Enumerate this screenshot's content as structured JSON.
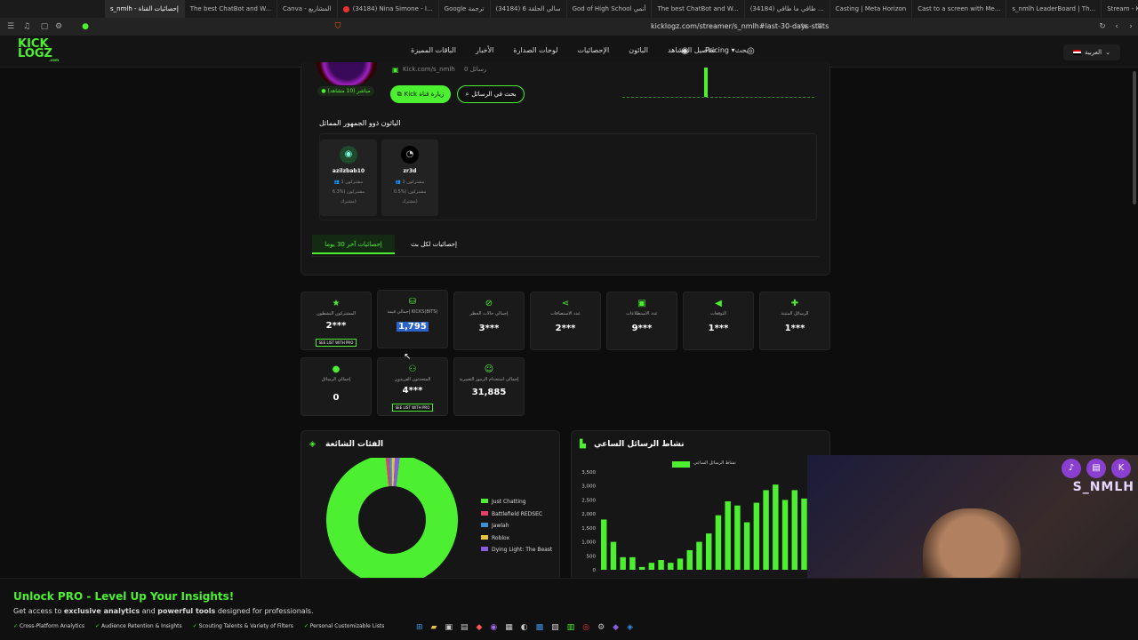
{
  "tabs": [
    {
      "label": "s_nmlh - إحصائيات القناة",
      "active": true
    },
    {
      "label": "The best ChatBot and W..."
    },
    {
      "label": "Canva - المشاريع"
    },
    {
      "label": "(34184) Nina Simone - I..."
    },
    {
      "label": "Google ترجمة"
    },
    {
      "label": "(34184) سالي الحلقة 6"
    },
    {
      "label": "God of High School أنمي"
    },
    {
      "label": "The best ChatBot and W..."
    },
    {
      "label": "(34184) طاقي ما طاقي ..."
    },
    {
      "label": "Casting | Meta Horizon"
    },
    {
      "label": "Cast to a screen with Me..."
    },
    {
      "label": "s_nmlh LeaderBoard | Th..."
    },
    {
      "label": "Stream - Kick Dashb..."
    }
  ],
  "address": {
    "url": "kicklogz.com/streamer/s_nmlh#last-30-days-stats"
  },
  "logo": {
    "line1": "KICK",
    "line2": "LOGZ",
    "suffix": ".com"
  },
  "nav": {
    "items": [
      "بحث",
      "تفاصيل المشاهد",
      "البائون",
      "الإحصائيات",
      "لوحات الصدارة",
      "الأخبار",
      "الباقات المميزة"
    ],
    "pricing": "Pricing",
    "lang": "العربية"
  },
  "profile": {
    "live_badge": "مباشر (10 مشاهد)",
    "kick_handle": "Kick.com/s_nmlh",
    "messages": "0 رسائل",
    "visit_btn": "Kick زيارة قناة",
    "search_btn": "بحث في الرسائل"
  },
  "similar": {
    "title": "الباثون ذوو الجمهور المماثل",
    "cards": [
      {
        "name": "azilzbab10",
        "l1": "مشتركون 1",
        "l2": "مشتركون (%6.3",
        "l3": "مشترك)"
      },
      {
        "name": "zr3d",
        "l1": "مشتركون 1",
        "l2": "مشتركون (%0.5",
        "l3": "مشترك)"
      }
    ]
  },
  "stat_tabs": {
    "active": "إحصائيات آخر 30 يوما",
    "other": "إحصائيات لكل بث"
  },
  "stats_row1": [
    {
      "label": "الرسائل المثبتة",
      "value": "1***",
      "icon": "pin-icon"
    },
    {
      "label": "التوقعات",
      "value": "1***",
      "icon": "megaphone-icon"
    },
    {
      "label": "عدد الاستطلاعات",
      "value": "9***",
      "icon": "poll-icon"
    },
    {
      "label": "عدد الاستضافات",
      "value": "2***",
      "icon": "share-icon"
    },
    {
      "label": "إجمالي حالات الحظر",
      "value": "3***",
      "icon": "ban-icon"
    },
    {
      "label": "إجمالي قيمة KICKS(BITS)",
      "value": "1,795",
      "icon": "coins-icon"
    },
    {
      "label": "المشتركون النشطون",
      "value": "2***",
      "icon": "star-icon",
      "pro": "SEE LIST WITH PRO"
    }
  ],
  "stats_row2": [
    {
      "label": "إجمالي استخدام الرموز التعبيرية",
      "value": "31,885",
      "icon": "smile-icon"
    },
    {
      "label": "المتحدثون الفريدون",
      "value": "4***",
      "icon": "users-icon",
      "pro": "SEE LIST WITH PRO"
    },
    {
      "label": "إجمالي الرسائل",
      "value": "0",
      "icon": "chat-icon"
    }
  ],
  "categories": {
    "title": "الفئات الشائعة",
    "legend": [
      {
        "name": "Just Chatting",
        "color": "#4cf030",
        "value": 96.5
      },
      {
        "name": "Battlefield REDSEC",
        "color": "#e83e6c",
        "value": 0.8
      },
      {
        "name": "Jawlah",
        "color": "#3b8fd6",
        "value": 0.7
      },
      {
        "name": "Roblox",
        "color": "#e5c33a",
        "value": 0.8
      },
      {
        "name": "Dying Light: The Beast",
        "color": "#8a5ce0",
        "value": 1.2
      }
    ]
  },
  "chart_data": {
    "type": "bar",
    "title": "نشاط الرسائل الساعي",
    "legend": "نشاط الرسائل الساعي",
    "ylim": [
      0,
      3500
    ],
    "yticks": [
      "3,500",
      "3,000",
      "2,500",
      "2,000",
      "1,500",
      "1,000",
      "500",
      "0"
    ],
    "values": [
      1800,
      1000,
      450,
      450,
      100,
      250,
      350,
      250,
      400,
      700,
      1000,
      1300,
      1950,
      2450,
      2300,
      1700,
      2400,
      2850,
      3050,
      2500,
      2850,
      2550
    ]
  },
  "promo": {
    "title": "Unlock PRO - Level Up Your Insights!",
    "desc_pre": "Get access to",
    "desc_b1": "exclusive analytics",
    "desc_mid": "and",
    "desc_b2": "powerful tools",
    "desc_post": "designed for professionals.",
    "features": [
      "Cross-Platform Analytics",
      "Audience Retention & Insights",
      "Scouting Talents & Variety of Filters",
      "Personal Customizable Lists"
    ]
  },
  "webcam": {
    "name": "S_NMLH"
  }
}
